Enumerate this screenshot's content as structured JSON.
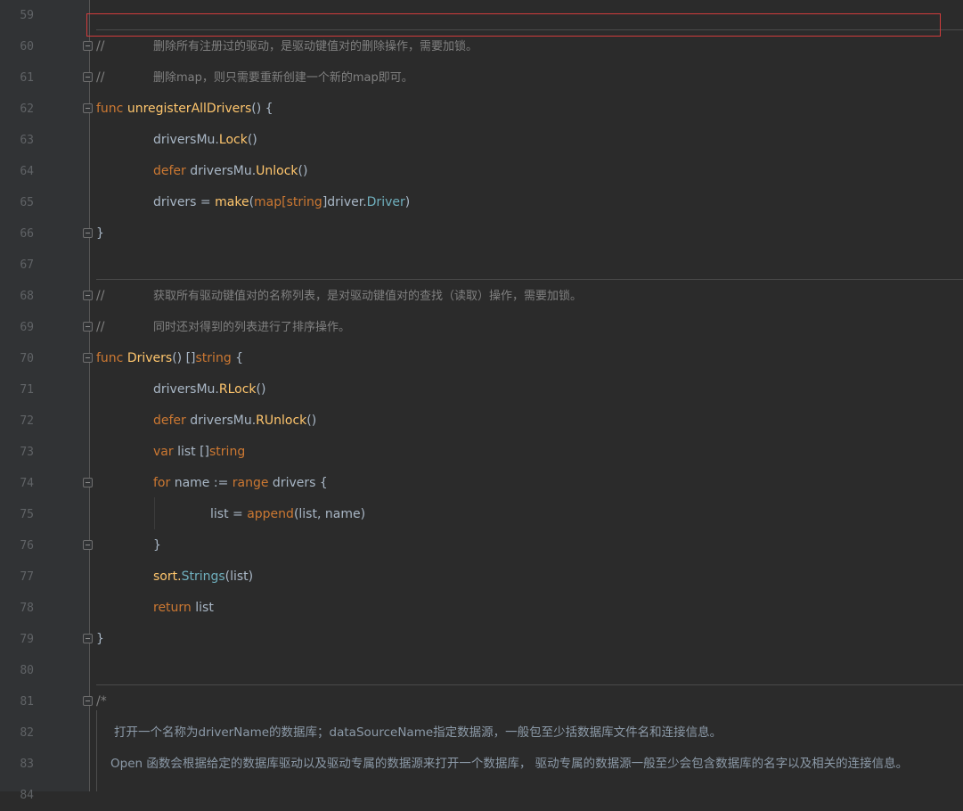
{
  "editor": {
    "lines": [
      {
        "num": "59"
      },
      {
        "num": "60",
        "comment_mark": "//",
        "comment_text": "删除所有注册过的驱动，是驱动键值对的删除操作，需要加锁。"
      },
      {
        "num": "61",
        "comment_mark": "//",
        "comment_text": "删除map，则只需要重新创建一个新的map即可。"
      },
      {
        "num": "62",
        "kw": "func",
        "name": "unregisterAllDrivers",
        "rest": "() {"
      },
      {
        "num": "63",
        "a": "driversMu.",
        "b": "Lock",
        "c": "()"
      },
      {
        "num": "64",
        "kw": "defer",
        "a": " driversMu.",
        "b": "Unlock",
        "c": "()"
      },
      {
        "num": "65",
        "a": "drivers = ",
        "b": "make",
        "c": "(",
        "d": "map",
        "e": "[",
        "f": "string",
        "g": "]driver.",
        "h": "Driver",
        "i": ")"
      },
      {
        "num": "66",
        "a": "}"
      },
      {
        "num": "67"
      },
      {
        "num": "68",
        "comment_mark": "//",
        "comment_text": "获取所有驱动键值对的名称列表，是对驱动键值对的查找（读取）操作，需要加锁。"
      },
      {
        "num": "69",
        "comment_mark": "//",
        "comment_text": "同时还对得到的列表进行了排序操作。"
      },
      {
        "num": "70",
        "kw": "func",
        "name": "Drivers",
        "mid": "() []",
        "typ": "string",
        "rest": " {"
      },
      {
        "num": "71",
        "a": "driversMu.",
        "b": "RLock",
        "c": "()"
      },
      {
        "num": "72",
        "kw": "defer",
        "a": " driversMu.",
        "b": "RUnlock",
        "c": "()"
      },
      {
        "num": "73",
        "kw": "var",
        "a": " list []",
        "typ": "string"
      },
      {
        "num": "74",
        "kw": "for",
        "a": " name := ",
        "kw2": "range",
        "b": " drivers {"
      },
      {
        "num": "75",
        "a": "list = ",
        "b": "append",
        "c": "(list, name)"
      },
      {
        "num": "76",
        "a": "}"
      },
      {
        "num": "77",
        "a": "sort.",
        "b": "Strings",
        "c": "(list)"
      },
      {
        "num": "78",
        "kw": "return",
        "a": " list"
      },
      {
        "num": "79",
        "a": "}"
      },
      {
        "num": "80"
      },
      {
        "num": "81",
        "a": "/*"
      },
      {
        "num": "82",
        "a": "打开一个名称为driverName的数据库；dataSourceName指定数据源，一般包至少括数据库文件名和连接信息。"
      },
      {
        "num": "83",
        "a": "Open 函数会根据给定的数据库驱动以及驱动专属的数据源来打开一个数据库， 驱动专属的数据源一般至少会包含数据库的名字以及相关的连接信息。"
      },
      {
        "num": "84"
      }
    ]
  },
  "colors": {
    "background": "#2b2b2b",
    "gutter": "#313335",
    "keyword": "#cc7832",
    "function_name": "#ffc66d",
    "comment": "#808080",
    "package_type": "#6fafbd",
    "highlight_border": "#d13c3c"
  }
}
